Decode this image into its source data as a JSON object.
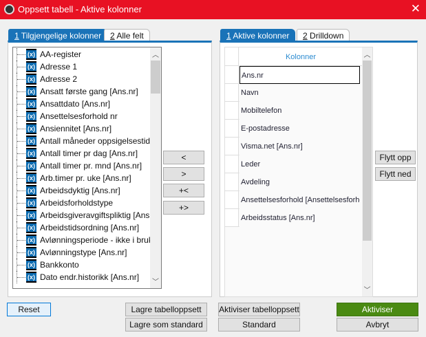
{
  "window": {
    "title": "Oppsett tabell - Aktive kolonner",
    "close": "✕"
  },
  "left": {
    "tabs": [
      {
        "num": "1",
        "label": " Tilgjengelige kolonner"
      },
      {
        "num": "2",
        "label": " Alle felt"
      }
    ],
    "items": [
      "AA-register",
      "Adresse 1",
      "Adresse 2",
      "Ansatt første gang [Ans.nr]",
      "Ansattdato [Ans.nr]",
      "Ansettelsesforhold nr",
      "Ansiennitet [Ans.nr]",
      "Antall måneder oppsigelsestid [Ans.nr]",
      "Antall timer pr dag [Ans.nr]",
      "Antall timer pr. mnd [Ans.nr]",
      "Arb.timer pr. uke [Ans.nr]",
      "Arbeidsdyktig [Ans.nr]",
      "Arbeidsforholdstype",
      "Arbeidsgiveravgiftspliktig [Ans.nr]",
      "Arbeidstidsordning [Ans.nr]",
      "Avlønningsperiode - ikke i bruk [Ans.nr]",
      "Avlønningstype [Ans.nr]",
      "Bankkonto",
      "Dato endr.historikk [Ans.nr]"
    ],
    "item_icon": "field-icon"
  },
  "move_buttons": [
    "<",
    ">",
    "+<",
    "+>"
  ],
  "right": {
    "tabs": [
      {
        "num": "1",
        "label": " Aktive kolonner"
      },
      {
        "num": "2",
        "label": " Drilldown"
      }
    ],
    "header": "Kolonner",
    "rows": [
      "Ans.nr",
      "Navn",
      "Mobiltelefon",
      "E-postadresse",
      "Visma.net [Ans.nr]",
      "Leder",
      "Avdeling",
      "Ansettelsesforhold [Ansettelsesforhold nr]",
      "Arbeidsstatus [Ans.nr]"
    ],
    "move_up": "Flytt opp",
    "move_down": "Flytt ned"
  },
  "footer": {
    "reset": "Reset",
    "save_layout": "Lagre tabelloppsett",
    "save_default": "Lagre som standard",
    "activate_layout": "Aktiviser tabelloppsett",
    "standard": "Standard",
    "activate": "Aktiviser",
    "cancel": "Avbryt"
  },
  "colors": {
    "titlebar": "#e81123",
    "accent": "#1a73b8",
    "activate": "#4a8a12"
  }
}
